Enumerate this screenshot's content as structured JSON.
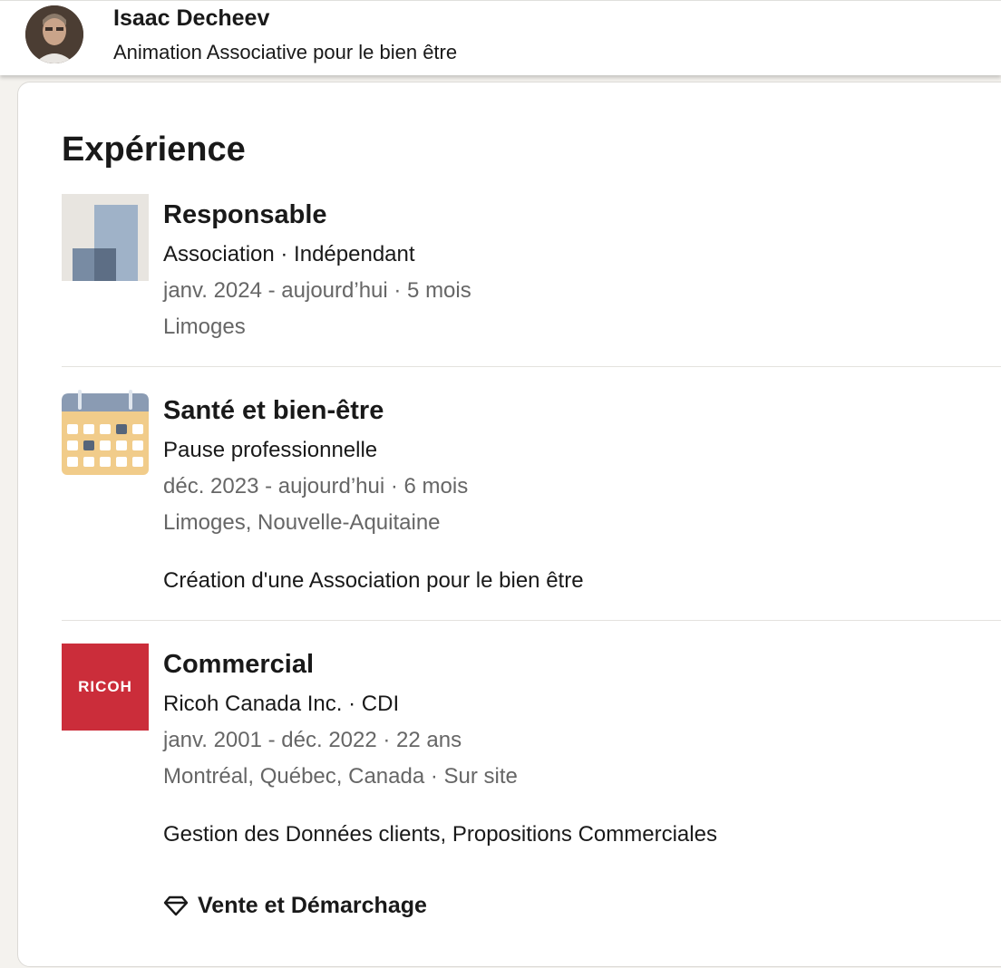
{
  "header": {
    "name": "Isaac Decheev",
    "headline": "Animation Associative pour le bien être"
  },
  "experience": {
    "title": "Expérience",
    "entries": [
      {
        "role": "Responsable",
        "org": "Association · Indépendant",
        "dates": "janv. 2024 - aujourd’hui · 5 mois",
        "location": "Limoges",
        "logo": "generic-company-logo"
      },
      {
        "role": "Santé et bien-être",
        "org": "Pause professionnelle",
        "dates": "déc. 2023 - aujourd’hui · 6 mois",
        "location": "Limoges, Nouvelle-Aquitaine",
        "description": "Création d'une Association pour le bien être",
        "logo": "calendar-icon"
      },
      {
        "role": "Commercial",
        "org": "Ricoh Canada Inc. · CDI",
        "dates": "janv. 2001 - déc. 2022 · 22 ans",
        "location": "Montréal, Québec, Canada · Sur site",
        "description": "Gestion des Données clients, Propositions Commerciales",
        "logo": "ricoh-logo",
        "logo_text": "RICOH",
        "skill": "Vente et Démarchage",
        "skill_icon": "diamond-icon"
      }
    ]
  },
  "colors": {
    "ricoh_red": "#cb2d3a",
    "calendar_yellow": "#f1cc8a",
    "calendar_header": "#8a9bb3",
    "generic_logo_bg": "#e8e5e0"
  }
}
